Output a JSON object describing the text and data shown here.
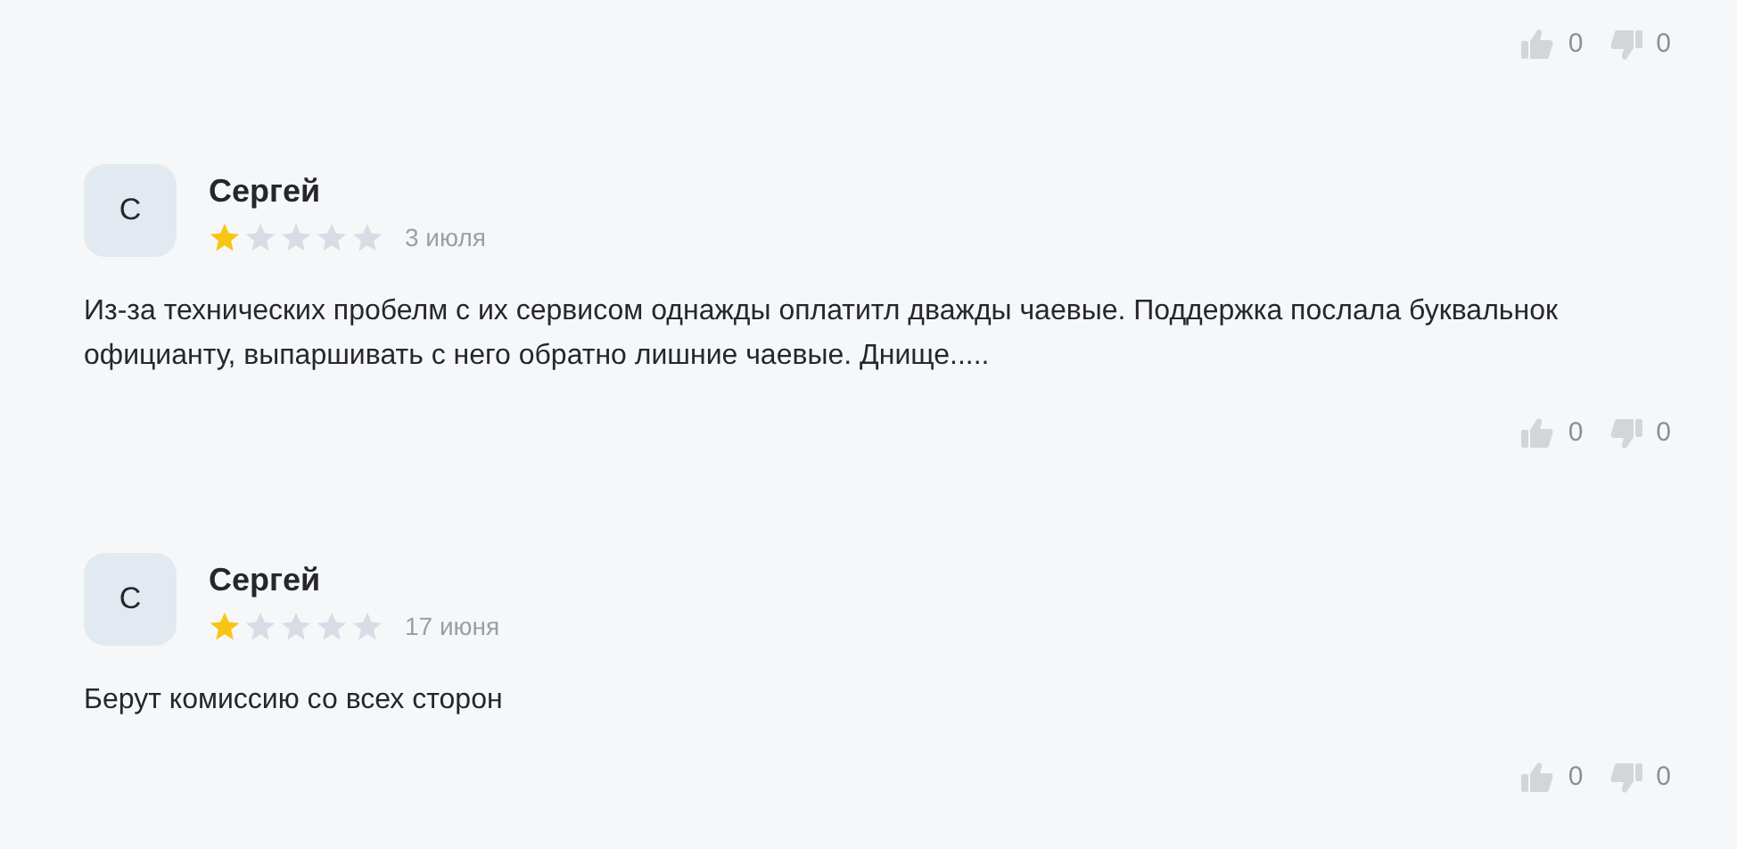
{
  "top_votes": {
    "likes": "0",
    "dislikes": "0"
  },
  "reviews": [
    {
      "avatar": "С",
      "name": "Сергей",
      "stars": 1,
      "date": "3 июля",
      "text": "Из-за технических пробелм с их сервисом однажды оплатитл дважды чаевые. Поддержка послала буквальнок официанту, выпаршивать с него обратно лишние чаевые. Днище.....",
      "likes": "0",
      "dislikes": "0"
    },
    {
      "avatar": "С",
      "name": "Сергей",
      "stars": 1,
      "date": "17 июня",
      "text": "Берут комиссию со всех сторон",
      "likes": "0",
      "dislikes": "0"
    }
  ]
}
